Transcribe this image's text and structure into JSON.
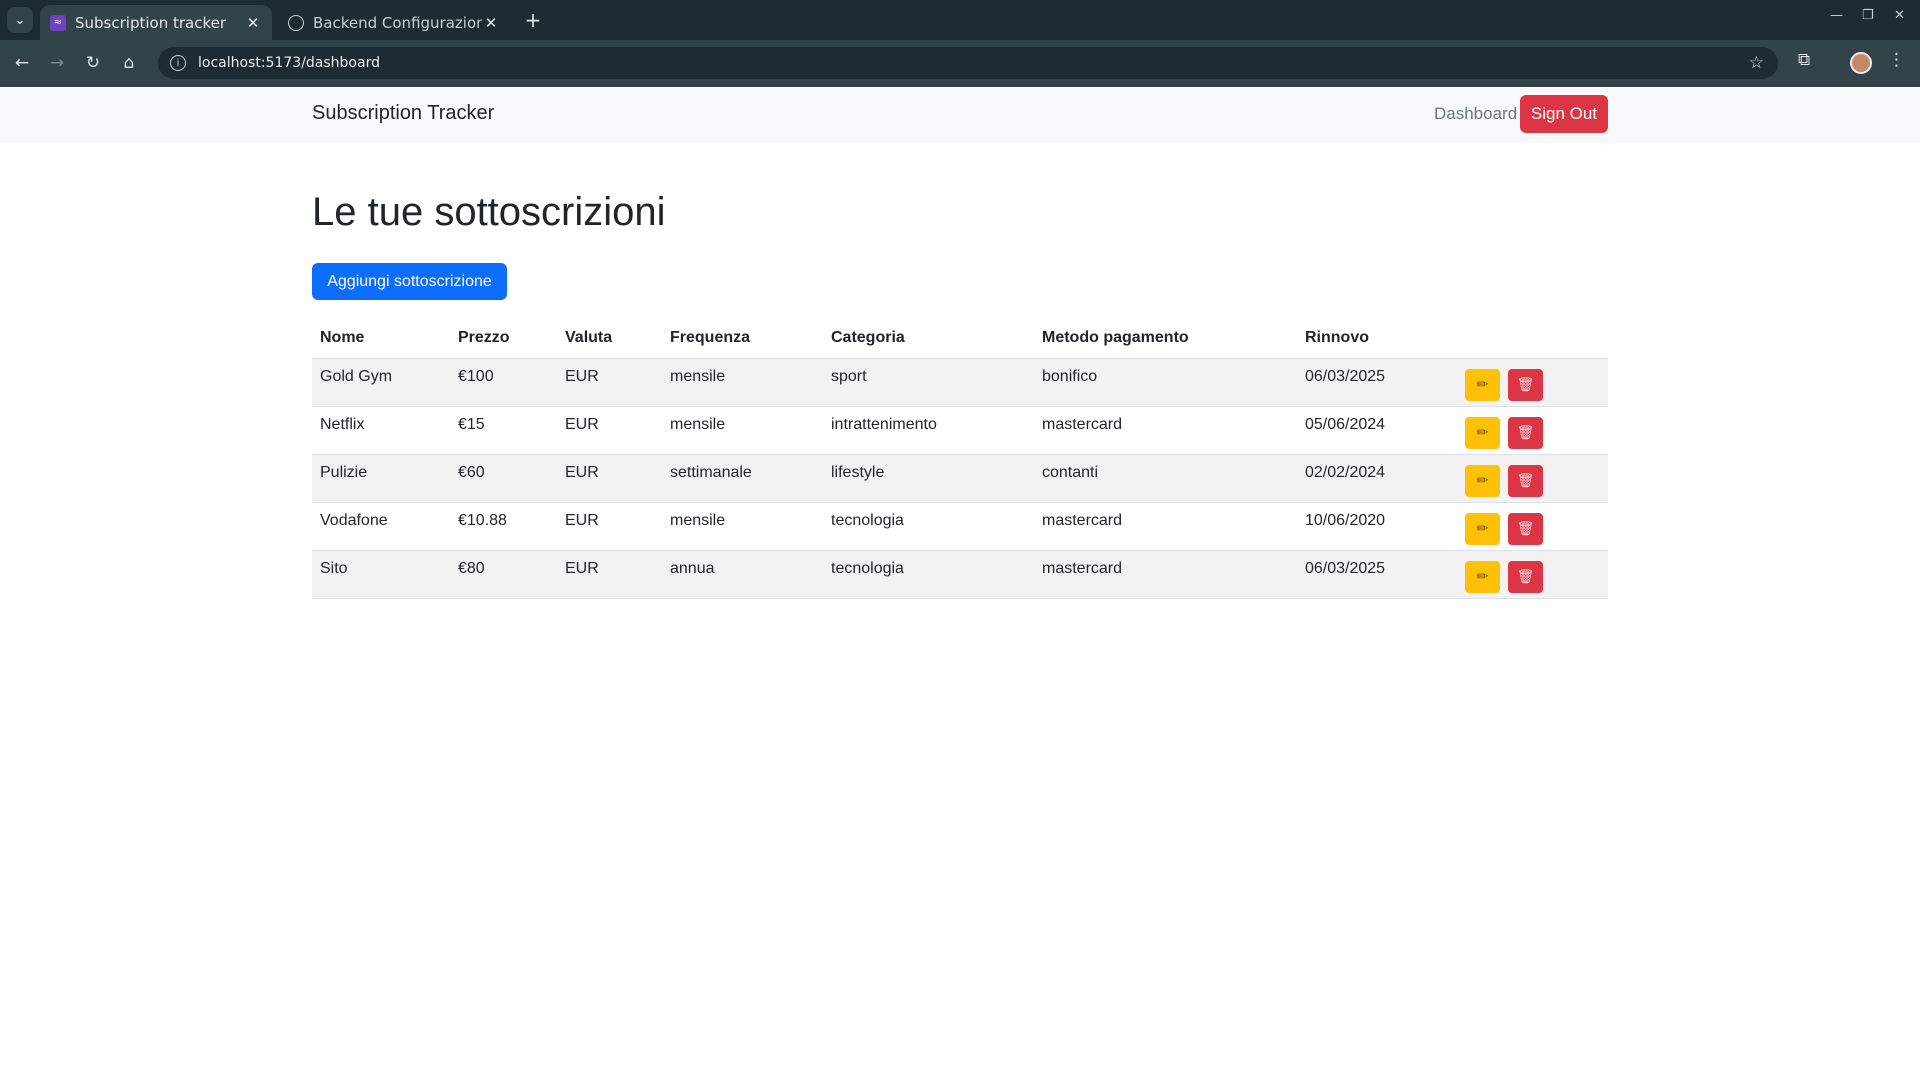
{
  "browser": {
    "tabs": [
      {
        "title": "Subscription tracker",
        "active": true
      },
      {
        "title": "Backend Configurazione",
        "active": false
      }
    ],
    "url": "localhost:5173/dashboard"
  },
  "navbar": {
    "brand": "Subscription Tracker",
    "dashboard_link": "Dashboard",
    "sign_out_label": "Sign Out"
  },
  "page": {
    "title": "Le tue sottoscrizioni",
    "add_button": "Aggiungi sottoscrizione"
  },
  "table": {
    "headers": [
      "Nome",
      "Prezzo",
      "Valuta",
      "Frequenza",
      "Categoria",
      "Metodo pagamento",
      "Rinnovo"
    ],
    "rows": [
      [
        "Gold Gym",
        "€100",
        "EUR",
        "mensile",
        "sport",
        "bonifico",
        "06/03/2025"
      ],
      [
        "Netflix",
        "€15",
        "EUR",
        "mensile",
        "intrattenimento",
        "mastercard",
        "05/06/2024"
      ],
      [
        "Pulizie",
        "€60",
        "EUR",
        "settimanale",
        "lifestyle",
        "contanti",
        "02/02/2024"
      ],
      [
        "Vodafone",
        "€10.88",
        "EUR",
        "mensile",
        "tecnologia",
        "mastercard",
        "10/06/2020"
      ],
      [
        "Sito",
        "€80",
        "EUR",
        "annua",
        "tecnologia",
        "mastercard",
        "06/03/2025"
      ]
    ]
  },
  "colors": {
    "primary": "#0d6efd",
    "danger": "#dc3545",
    "warning": "#ffc107"
  }
}
